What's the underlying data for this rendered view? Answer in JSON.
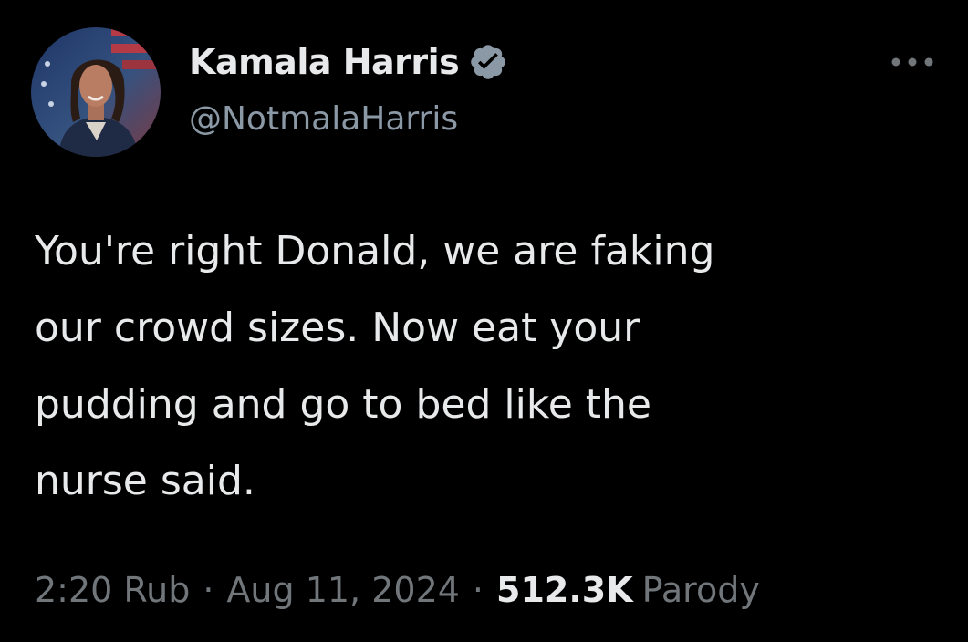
{
  "author": {
    "name": "Kamala Harris",
    "handle": "@NotmalaHarris",
    "verified": true,
    "verified_color": "#8b98a5"
  },
  "tweet": {
    "text": "You're right Donald, we are faking\nour crowd sizes. Now eat your\npudding and go to bed like the\nnurse said."
  },
  "meta": {
    "time": "2:20 Rub",
    "separator": "·",
    "date": "Aug 11, 2024",
    "views_count": "512.3K",
    "views_label": "Parody"
  },
  "icons": {
    "more": "more-horizontal-icon",
    "verified": "verified-badge-icon"
  },
  "colors": {
    "background": "#000000",
    "primary_text": "#e7e9ea",
    "secondary_text": "#71767b"
  }
}
